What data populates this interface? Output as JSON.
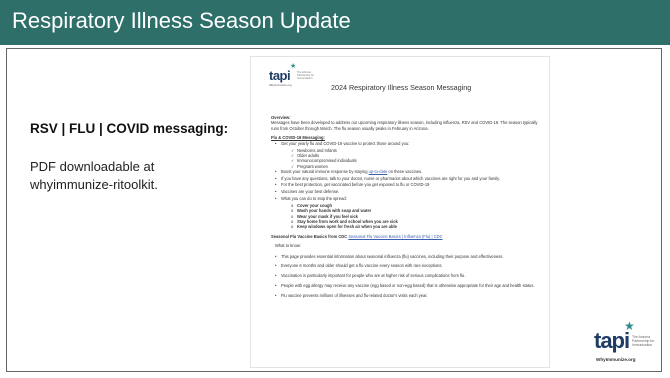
{
  "slide": {
    "title": "Respiratory Illness Season Update",
    "left_heading": "RSV | FLU | COVID messaging:",
    "left_body_lines": [
      "PDF downloadable at",
      "whyimmunize-ritoolkit."
    ]
  },
  "document": {
    "logo_text": "tapi",
    "logo_subtitle": "The Arizona Partnership for Immunization",
    "logo_url": "WhyImmunize.org",
    "title": "2024 Respiratory Illness Season Messaging",
    "overview_heading": "Overview:",
    "overview_text": "Messages have been developed to address our upcoming respiratory illness season, including influenza, RSV and COVID-19. The season typically runs from October through March. The flu season usually peaks in February in Arizona.",
    "flu_heading": "Flu & COVID-19 Messaging:",
    "flu_bullet_1": "Get your yearly flu and COVID-19 vaccine to protect those around you:",
    "flu_checks": [
      "Newborns and Infants",
      "Older adults",
      "Immunocompromised individuals",
      "Pregnant women"
    ],
    "flu_bullet_2_pre": "Boost your natural immune response by staying ",
    "flu_bullet_2_link": "up-to-date",
    "flu_bullet_2_post": " on these vaccines.",
    "flu_bullet_3": "If you have any questions, talk to your doctor, nurse or pharmacist about which vaccines are right for you and your family.",
    "flu_bullet_4": "For the best protection, get vaccinated before you get exposed to flu or COVID-19",
    "flu_bullet_5": "Vaccines are your best defense.",
    "flu_bullet_6": "What you can do to stop the spread:",
    "spread_items": [
      "Cover your cough",
      "Wash your hands with soap and water",
      "Wear your mask if you feel sick",
      "Stay home from work and school when you are sick",
      "Keep windows open for fresh air when you are able"
    ],
    "basics_heading": "Seasonal Flu Vaccine Basics from CDC",
    "basics_link": "Seasonal Flu Vaccine Basics | Influenza (Flu) | CDC",
    "what_to_know": "What to know:",
    "basics_bullets": [
      "This page provides essential information about seasonal influenza (flu) vaccines, including their purpose and effectiveness.",
      "Everyone 6 months and older should get a flu vaccine every season with rare exceptions.",
      "Vaccination is particularly important for people who are at higher risk of serious complications from flu.",
      "People with egg allergy may receive any vaccine (egg based or non-egg based) that is otherwise appropriate for their age and health status.",
      "Flu vaccine prevents millions of illnesses and flu-related doctor's visits each year."
    ]
  },
  "corner_logo": {
    "text": "tapi",
    "subtitle": "The Arizona Partnership for Immunization",
    "url": "WhyImmunize.org"
  },
  "colors": {
    "header_bg": "#2e6f6a",
    "logo_navy": "#1e3c64",
    "logo_teal": "#2e8b8b"
  }
}
